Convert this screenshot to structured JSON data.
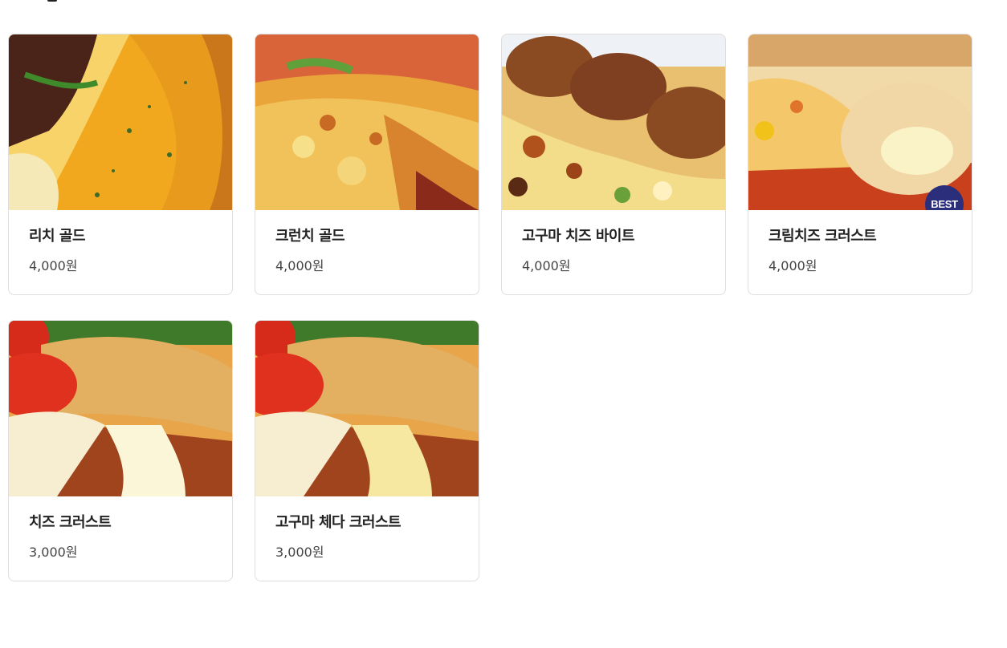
{
  "products": [
    {
      "name": "리치 골드",
      "price": "4,000원",
      "badge": "",
      "image": "rich-gold-pizza-photo"
    },
    {
      "name": "크런치 골드",
      "price": "4,000원",
      "badge": "",
      "image": "crunch-gold-pizza-photo"
    },
    {
      "name": "고구마 치즈 바이트",
      "price": "4,000원",
      "badge": "",
      "image": "sweet-potato-cheese-bite-photo"
    },
    {
      "name": "크림치즈 크러스트",
      "price": "4,000원",
      "badge": "BEST",
      "image": "cream-cheese-crust-photo"
    },
    {
      "name": "치즈 크러스트",
      "price": "3,000원",
      "badge": "",
      "image": "cheese-crust-photo"
    },
    {
      "name": "고구마 체다 크러스트",
      "price": "3,000원",
      "badge": "",
      "image": "sweet-potato-cheddar-crust-photo"
    }
  ],
  "colors": {
    "badge_bg": "#2b2e7a",
    "card_border": "#dedede",
    "text": "#222222"
  }
}
